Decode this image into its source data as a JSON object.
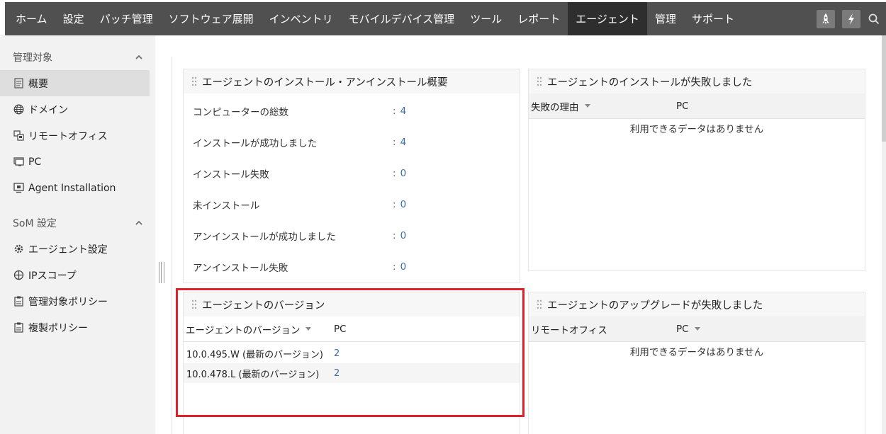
{
  "nav": {
    "items": [
      "ホーム",
      "設定",
      "パッチ管理",
      "ソフトウェア展開",
      "インベントリ",
      "モバイルデバイス管理",
      "ツール",
      "レポート",
      "エージェント",
      "管理",
      "サポート"
    ],
    "active_index": 8,
    "icons": [
      "rocket-icon",
      "lightning-icon",
      "search-icon"
    ]
  },
  "sidebar": {
    "section1": "管理対象",
    "items1": [
      {
        "label": "概要",
        "icon": "document-icon",
        "active": true
      },
      {
        "label": "ドメイン",
        "icon": "globe-icon"
      },
      {
        "label": "リモートオフィス",
        "icon": "remote-office-icon"
      },
      {
        "label": "PC",
        "icon": "pc-icon"
      },
      {
        "label": "Agent Installation",
        "icon": "monitor-icon"
      }
    ],
    "section2": "SoM 設定",
    "items2": [
      {
        "label": "エージェント設定",
        "icon": "gear-icon"
      },
      {
        "label": "IPスコープ",
        "icon": "crosshair-icon"
      },
      {
        "label": "管理対象ポリシー",
        "icon": "policy-icon"
      },
      {
        "label": "複製ポリシー",
        "icon": "policy-copy-icon"
      }
    ]
  },
  "summary_panel": {
    "title": "エージェントのインストール・アンインストール概要",
    "rows": [
      {
        "label": "コンピューターの総数",
        "value": "4"
      },
      {
        "label": "インストールが成功しました",
        "value": "4"
      },
      {
        "label": "インストール失敗",
        "value": "0"
      },
      {
        "label": "未インストール",
        "value": "0"
      },
      {
        "label": "アンインストールが成功しました",
        "value": "0"
      },
      {
        "label": "アンインストール失敗",
        "value": "0"
      }
    ]
  },
  "install_failed_panel": {
    "title": "エージェントのインストールが失敗しました",
    "col1": "失敗の理由",
    "col2": "PC",
    "empty": "利用できるデータはありません"
  },
  "version_panel": {
    "title": "エージェントのバージョン",
    "col1": "エージェントのバージョン",
    "col2": "PC",
    "rows": [
      {
        "version": "10.0.495.W (最新のバージョン)",
        "pc": "2"
      },
      {
        "version": "10.0.478.L (最新のバージョン)",
        "pc": "2"
      }
    ]
  },
  "upgrade_failed_panel": {
    "title": "エージェントのアップグレードが失敗しました",
    "col1": "リモートオフィス",
    "col2": "PC",
    "empty": "利用できるデータはありません"
  },
  "colors": {
    "nav_bg": "#505050",
    "active_nav": "#2e2e2e",
    "link": "#3a6ea5",
    "highlight": "#e0202a"
  }
}
